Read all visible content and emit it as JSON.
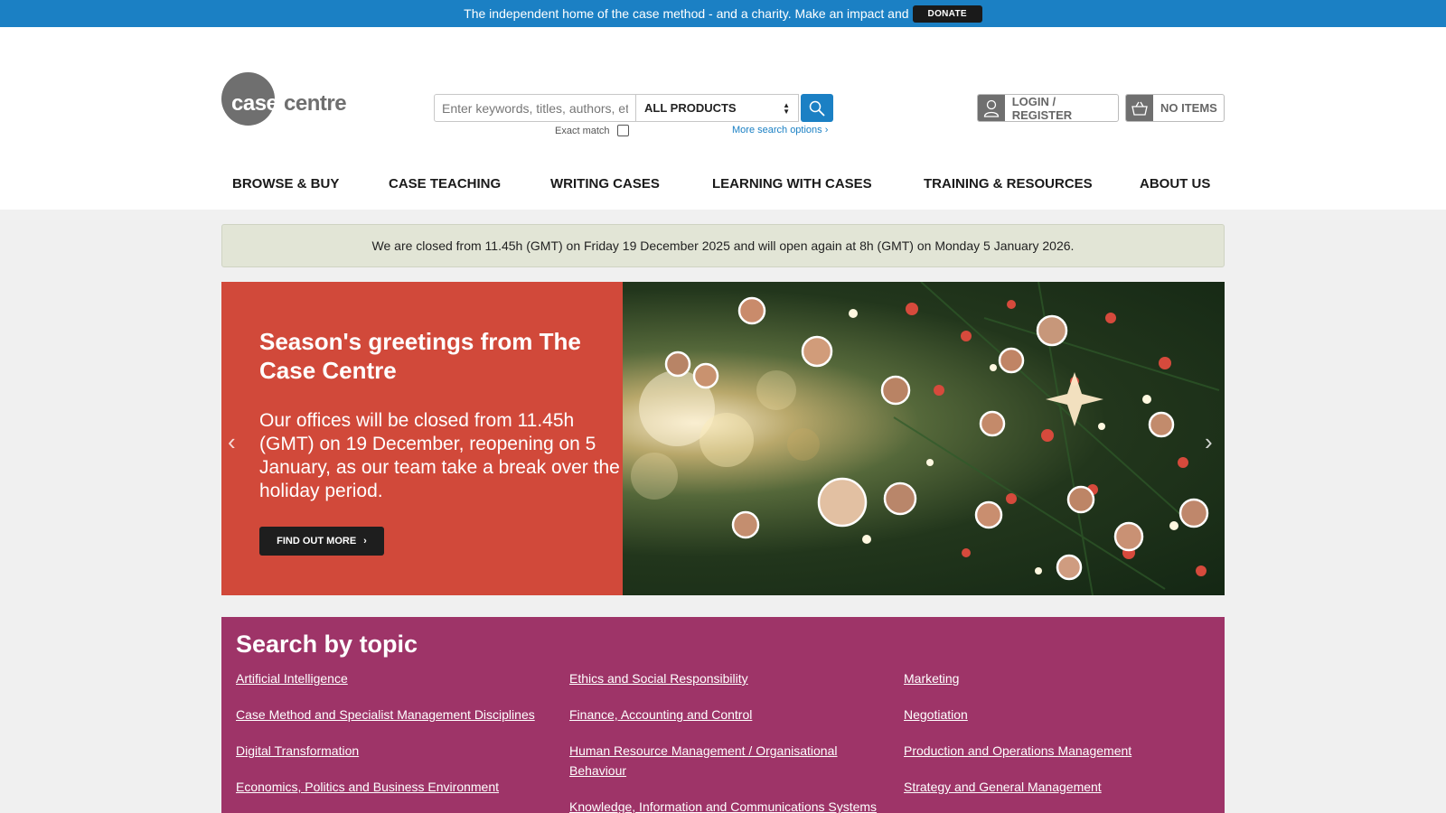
{
  "topbar": {
    "text": "The independent home of the case method - and a charity. Make an impact and",
    "donate_label": "DONATE"
  },
  "logo": {
    "word1": "case",
    "word2": "centre"
  },
  "search": {
    "placeholder": "Enter keywords, titles, authors, etc",
    "product_select": "ALL PRODUCTS",
    "exact_match_label": "Exact match",
    "exact_match_checked": false,
    "more_options_label": "More search options"
  },
  "account": {
    "login_label": "LOGIN / REGISTER",
    "cart_label": "NO ITEMS"
  },
  "nav": {
    "items": [
      "BROWSE & BUY",
      "CASE TEACHING",
      "WRITING CASES",
      "LEARNING WITH CASES",
      "TRAINING & RESOURCES",
      "ABOUT US"
    ]
  },
  "notice": {
    "text": "We are closed from 11.45h (GMT) on Friday 19 December 2025 and will open again at 8h (GMT) on Monday 5 January 2026."
  },
  "hero": {
    "title": "Season's greetings from The Case Centre",
    "body": "Our offices will be closed from 11.45h (GMT) on 19 December, reopening on 5 January, as our team take a break over the holiday period.",
    "cta_label": "FIND OUT MORE",
    "prev_label": "‹",
    "next_label": "›"
  },
  "topics": {
    "heading": "Search by topic",
    "columns": [
      [
        "Artificial Intelligence",
        "Case Method and Specialist Management Disciplines",
        "Digital Transformation",
        "Economics, Politics and Business Environment"
      ],
      [
        "Ethics and Social Responsibility",
        "Finance, Accounting and Control",
        "Human Resource Management / Organisational Behaviour",
        "Knowledge, Information and Communications Systems"
      ],
      [
        "Marketing",
        "Negotiation",
        "Production and Operations Management",
        "Strategy and General Management"
      ]
    ]
  },
  "colors": {
    "topbar": "#1b80c4",
    "hero_panel": "#d1493a",
    "topics_panel": "#9e3468",
    "notice_bg": "#e2e5d6"
  }
}
